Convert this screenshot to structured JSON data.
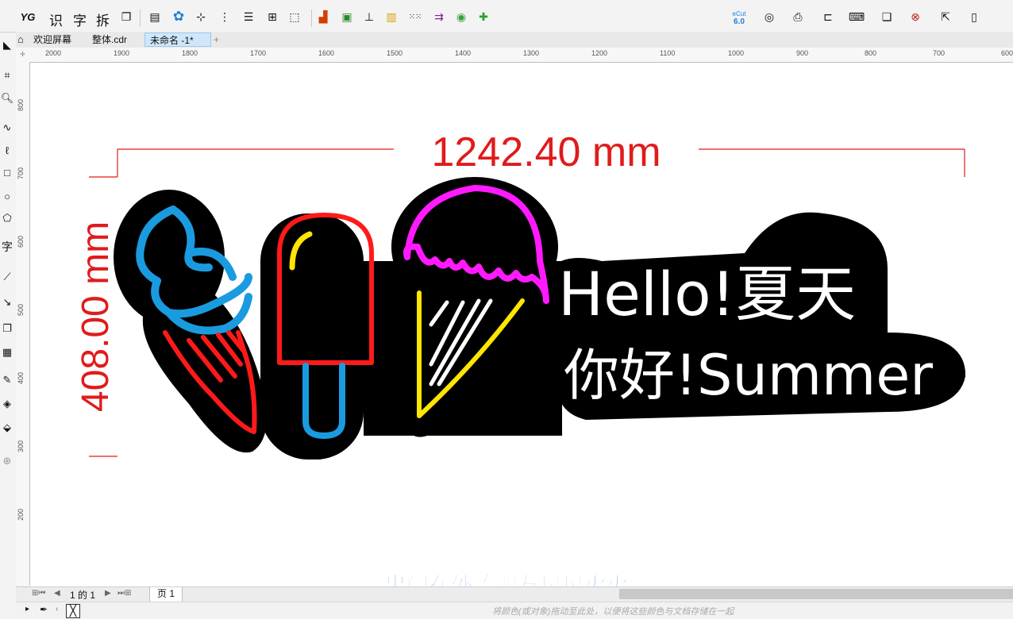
{
  "toolbar": {
    "text_buttons": [
      "识",
      "字",
      "拆"
    ],
    "ecut_label": "eCut",
    "ecut_version": "6.0"
  },
  "tabs": [
    {
      "label": "欢迎屏幕"
    },
    {
      "label": "整体.cdr"
    },
    {
      "label": "未命名 -1*"
    }
  ],
  "ruler": {
    "h_labels": [
      "2000",
      "1900",
      "1800",
      "1700",
      "1600",
      "1500",
      "1400",
      "1300",
      "1200",
      "1100",
      "1000",
      "900",
      "800",
      "700",
      "600"
    ],
    "v_labels": [
      "800",
      "700",
      "600",
      "500",
      "400",
      "300",
      "200"
    ]
  },
  "design": {
    "width_dimension": "1242.40 mm",
    "height_dimension": "408.00 mm",
    "text_line1": "Hello!夏天",
    "text_line2": "你好!Summer"
  },
  "pagebar": {
    "page_counter": "1 的 1",
    "page_tab": "页 1"
  },
  "statusbar": {
    "hint": "将颜色(或对象)拖动至此处，以便将这些颜色与文档存储在一起"
  },
  "subtitle": "出门在外的朋友风风火火",
  "colors": {
    "dimension": "#e01b1b",
    "neon_blue": "#1a9be0",
    "neon_red": "#ff1a1a",
    "neon_yellow": "#ffe600",
    "neon_magenta": "#ff1aff",
    "subtitle": "#1d6fd6"
  }
}
